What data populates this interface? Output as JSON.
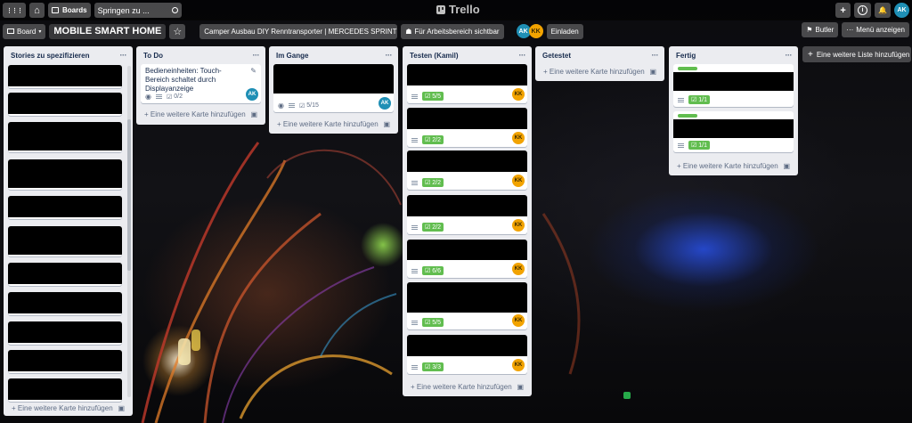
{
  "topbar": {
    "apps_label": "⋮⋮⋮",
    "home_label": "⌂",
    "boards_label": "Boards",
    "search_placeholder": "Springen zu ...",
    "logo_text": "Trello",
    "add_label": "+",
    "info_label": "i",
    "notif_label": "🔔",
    "user_initials": "AK"
  },
  "board": {
    "menu_label": "Board",
    "title": "MOBILE SMART HOME",
    "star_label": "☆",
    "team_label": "Camper Ausbau DIY Renntransporter | MERCEDES SPRINTER   F...",
    "visibility_label": "Für Arbeitsbereich sichtbar",
    "members": [
      "AK",
      "KK"
    ],
    "invite_label": "Einladen",
    "butler_label": "Butler",
    "show_menu_label": "Menü anzeigen"
  },
  "add_list_label": "Eine weitere Liste hinzufügen",
  "lists": [
    {
      "title": "Stories zu spezifizieren",
      "add_label": "Eine weitere Karte hinzufügen",
      "cards": [
        {},
        {},
        {},
        {},
        {},
        {},
        {},
        {},
        {},
        {},
        {},
        {}
      ]
    },
    {
      "title": "To Do",
      "add_label": "Eine weitere Karte hinzufügen",
      "cards": [
        {
          "title": "Bedieneinheiten: Touch-Bereich schaltet durch Displayanzeige",
          "checklist": "0/2",
          "member": "AK"
        }
      ]
    },
    {
      "title": "Im Gange",
      "add_label": "Eine weitere Karte hinzufügen",
      "cards": [
        {
          "checklist": "5/15",
          "member": "AK"
        }
      ]
    },
    {
      "title": "Testen (Kamil)",
      "add_label": "Eine weitere Karte hinzufügen",
      "cards": [
        {
          "checklist": "5/5",
          "member": "KK"
        },
        {
          "checklist": "2/2",
          "member": "KK"
        },
        {
          "checklist": "2/2",
          "member": "KK"
        },
        {
          "checklist": "2/2",
          "member": "KK"
        },
        {
          "checklist": "6/6",
          "member": "KK"
        },
        {
          "checklist": "5/5",
          "member": "KK"
        },
        {
          "checklist": "3/3",
          "member": "KK"
        }
      ]
    },
    {
      "title": "Getestet",
      "add_label": "Eine weitere Karte hinzufügen",
      "cards": []
    },
    {
      "title": "Fertig",
      "add_label": "Eine weitere Karte hinzufügen",
      "cards": [
        {
          "checklist": "1/1",
          "label_color": "#61bd4f"
        },
        {
          "checklist": "1/1",
          "label_color": "#61bd4f"
        }
      ]
    }
  ],
  "icons": {
    "check": "☑",
    "eye": "◉",
    "pencil": "✎",
    "plus": "+",
    "card_template": "▣",
    "more": "···"
  },
  "colors": {
    "avatar_ak": "#1f8fb5",
    "avatar_kk": "#f2a300",
    "checklist_complete": "#61bd4f"
  }
}
